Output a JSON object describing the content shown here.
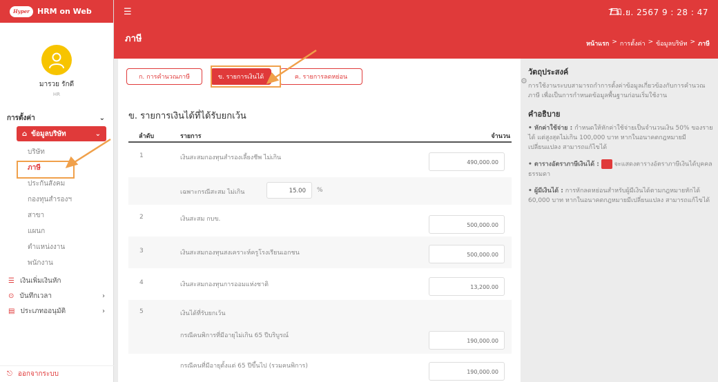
{
  "brand": {
    "logo_text": "Hyper",
    "app_name": "HRM on Web"
  },
  "topbar": {
    "datetime": "7 มิ.ย. 2567  9 : 28 : 47"
  },
  "profile": {
    "name": "มารวย รักดี",
    "role": "HR"
  },
  "sidebar": {
    "section_label": "การตั้งค่า",
    "group_label": "ข้อมูลบริษัท",
    "sub_items": [
      "บริษัท",
      "ภาษี",
      "ประกันสังคม",
      "กองทุนสำรองฯ",
      "สาขา",
      "แผนก",
      "ตำแหน่งงาน",
      "พนักงาน"
    ],
    "main_items": [
      "เงินเพิ่มเงินหัก",
      "บันทึกเวลา",
      "ประเภทออนุมัติ"
    ],
    "logout": "ออกจากระบบ"
  },
  "page": {
    "title": "ภาษี",
    "breadcrumb": {
      "home": "หน้าแรก",
      "sep": ">",
      "b1": "การตั้งค่า",
      "b2": "ข้อมูลบริษัท",
      "current": "ภาษี"
    }
  },
  "tabs": [
    "ก. การคำนวณภาษี",
    "ข. รายการเงินได้",
    "ค. รายการลดหย่อน"
  ],
  "section_title": "ข. รายการเงินได้ที่ได้รับยกเว้น",
  "table": {
    "headers": {
      "no": "ลำดับ",
      "item": "รายการ",
      "amount": "จำนวน"
    },
    "rows": [
      {
        "no": "1",
        "desc": "เงินสะสมกองทุนสำรองเลี้ยงชีพ ไม่เกิน",
        "amount": "490,000.00"
      },
      {
        "no": "",
        "desc": "เฉพาะกรณีสะสม ไม่เกิน",
        "percent": "15.00",
        "unit": "%"
      },
      {
        "no": "2",
        "desc": "เงินสะสม กบข.",
        "amount": "500,000.00"
      },
      {
        "no": "3",
        "desc": "เงินสะสมกองทุนสงเคราะห์ครูโรงเรียนเอกชน",
        "amount": "500,000.00"
      },
      {
        "no": "4",
        "desc": "เงินสะสมกองทุนการออมแห่งชาติ",
        "amount": "13,200.00"
      },
      {
        "no": "5",
        "desc": "เงินได้ที่รับยกเว้น",
        "amount": ""
      },
      {
        "no": "",
        "desc": "กรณีคนพิการที่มีอายุไม่เกิน 65 ปีบริบูรณ์",
        "amount": "190,000.00"
      },
      {
        "no": "",
        "desc": "กรณีคนที่มีอายุตั้งแต่ 65 ปีขึ้นไป (รวมคนพิการ)",
        "amount": "190,000.00"
      }
    ]
  },
  "right_panel": {
    "objective_title": "วัตถุประสงค์",
    "objective_text": "การใช้งานระบบสามารถกำการตั้งค่าข้อมูลเกี่ยวข้องกับการคำนวณภาษี เพื่อเป็นการกำหนดข้อมูลพื้นฐานก่อนเริ่มใช้งาน",
    "desc_title": "คำอธิบาย",
    "p1_label": "• หักค่าใช้จ่าย :",
    "p1_text": "กำหนดให้หักค่าใช้จ่ายเป็นจำนวนเงิน 50% ของรายได้ แต่สูงสุดไม่เกิน 100,000 บาท หากในอนาคตกฎหมายมีเปลี่ยนแปลง สามารถแก้ไขได้",
    "p2_label": "• ตารางอัตราภาษีเงินได้ :",
    "p2_text": "จะแสดงตารางอัตราภาษีเงินได้บุคคลธรรมดา",
    "p3_label": "• ผู้มีเงินได้ :",
    "p3_text": "การหักลดหย่อนสำหรับผู้มีเงินได้ตามกฎหมายหักได้ 60,000 บาท หากในอนาคตกฎหมายมีเปลี่ยนแปลง สามารถแก้ไขได้"
  },
  "colors": {
    "primary": "#e03a3a",
    "highlight": "#f0a04a",
    "avatar": "#f7c400"
  }
}
